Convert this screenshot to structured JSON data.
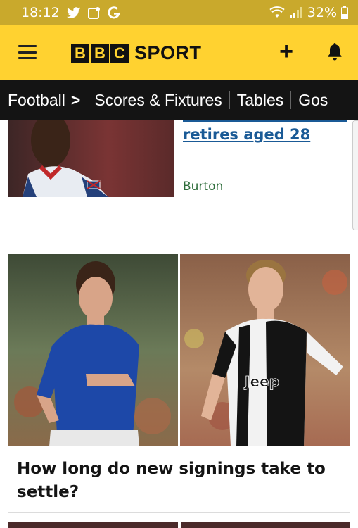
{
  "status_bar": {
    "time": "18:12",
    "battery": "32%",
    "icons": [
      "twitter-icon",
      "notification-app-icon",
      "google-icon",
      "wifi-icon",
      "signal-icon",
      "battery-icon"
    ]
  },
  "header": {
    "logo_letters": [
      "B",
      "B",
      "C"
    ],
    "logo_word": "SPORT",
    "menu_icon": "hamburger-menu-icon",
    "add_icon": "plus-icon",
    "notifications_icon": "bell-icon",
    "add_label": "+"
  },
  "nav": {
    "section": "Football",
    "chevron": ">",
    "tabs": [
      "Scores & Fixtures",
      "Tables",
      "Gos"
    ]
  },
  "story1": {
    "headline_tail": "retires aged 28",
    "tag": "Burton"
  },
  "story2": {
    "headline": "How long do new signings take to settle?"
  },
  "colors": {
    "header_yellow": "#ffd230",
    "status_bar": "#c9a92c",
    "nav_black": "#141414",
    "link_blue": "#1a5a96",
    "tag_green": "#2f6e3c"
  }
}
